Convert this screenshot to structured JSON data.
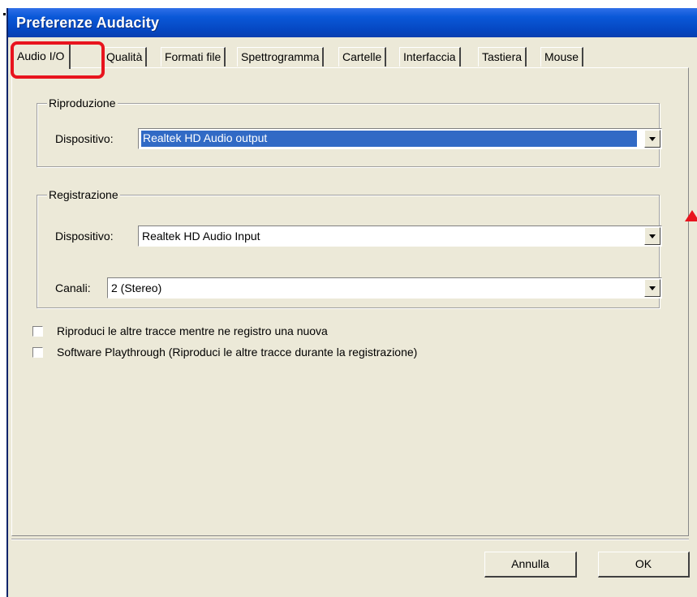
{
  "window": {
    "title": "Preferenze Audacity"
  },
  "tabs": [
    {
      "label": "Audio I/O",
      "active": true
    },
    {
      "label": "Qualità"
    },
    {
      "label": "Formati file"
    },
    {
      "label": "Spettrogramma"
    },
    {
      "label": "Cartelle"
    },
    {
      "label": "Interfaccia"
    },
    {
      "label": "Tastiera"
    },
    {
      "label": "Mouse"
    }
  ],
  "playback": {
    "group_label": "Riproduzione",
    "device_label": "Dispositivo:",
    "device_value": "Realtek HD Audio output"
  },
  "recording": {
    "group_label": "Registrazione",
    "device_label": "Dispositivo:",
    "device_value": "Realtek HD Audio Input",
    "channels_label": "Canali:",
    "channels_value": "2 (Stereo)"
  },
  "options": [
    {
      "label": "Riproduci le altre tracce mentre ne registro una nuova",
      "checked": false
    },
    {
      "label": "Software Playthrough (Riproduci le altre tracce durante la registrazione)",
      "checked": false
    }
  ],
  "buttons": {
    "cancel": "Annulla",
    "ok": "OK"
  },
  "annotation_color": "#e8141e",
  "title_bar_color": "#0547c2"
}
